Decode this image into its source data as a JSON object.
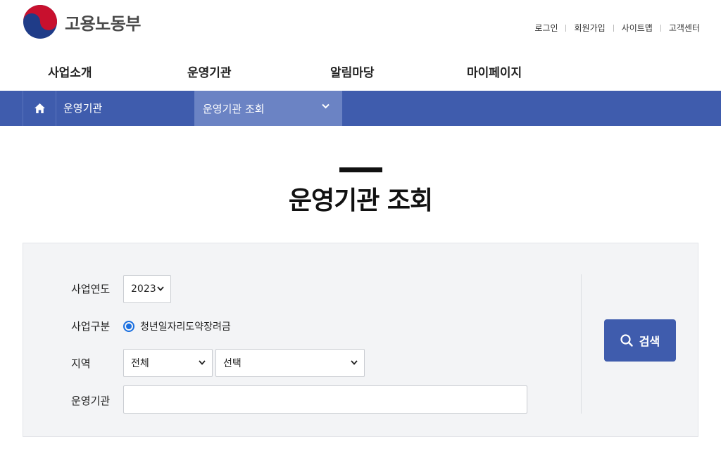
{
  "header": {
    "logo_text": "고용노동부",
    "util_links": [
      "로그인",
      "회원가입",
      "사이트맵",
      "고객센터"
    ]
  },
  "gnb": {
    "items": [
      "사업소개",
      "운영기관",
      "알림마당",
      "마이페이지"
    ]
  },
  "location": {
    "depth1": "운영기관",
    "depth2": "운영기관 조회"
  },
  "page": {
    "title": "운영기관 조회"
  },
  "search": {
    "year_label": "사업연도",
    "year_value": "2023",
    "type_label": "사업구분",
    "type_option": "청년일자리도약장려금",
    "region_label": "지역",
    "region_value": "전체",
    "subregion_value": "선택",
    "org_label": "운영기관",
    "org_value": "",
    "search_button": "검색"
  },
  "colors": {
    "primary": "#3f5cad",
    "accent_tab": "#6b83c4",
    "search_bg": "#f3f4f6"
  }
}
